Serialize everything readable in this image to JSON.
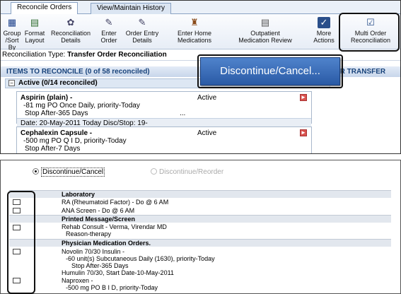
{
  "tabs": [
    {
      "label": "Reconcile Orders"
    },
    {
      "label": "View/Maintain History"
    }
  ],
  "toolbar": [
    {
      "icon": "group-sort-icon",
      "line1": "Group",
      "line2": "/Sort By"
    },
    {
      "icon": "format-layout-icon",
      "line1": "Format",
      "line2": "Layout"
    },
    {
      "icon": "reconciliation-details-icon",
      "line1": "Reconciliation",
      "line2": "Details"
    },
    {
      "icon": "enter-order-icon",
      "line1": "Enter",
      "line2": "Order"
    },
    {
      "icon": "order-entry-details-icon",
      "line1": "Order Entry",
      "line2": "Details"
    },
    {
      "icon": "enter-home-medications-icon",
      "line1": "Enter Home",
      "line2": "Medications"
    },
    {
      "icon": "outpatient-medication-review-icon",
      "line1": "Outpatient",
      "line2": "Medication Review"
    },
    {
      "icon": "more-actions-icon",
      "line1": "More",
      "line2": "Actions"
    },
    {
      "icon": "multi-order-reconciliation-icon",
      "line1": "Multi Order",
      "line2": "Reconciliation"
    }
  ],
  "recon_type": {
    "label": "Reconciliation Type:",
    "value": "Transfer Order Reconciliation"
  },
  "items_header": {
    "left": "ITEMS TO RECONCILE (0 of 58 reconciled)",
    "right": "ER TRANSFER"
  },
  "active_group": {
    "label": "Active (0/14 reconciled)"
  },
  "orders": [
    {
      "name": "Aspirin (plain) -",
      "status": "Active",
      "line2": "-81 mg PO Once  Daily, priority-Today",
      "line3": "Stop After-365 Days",
      "date": "Date: 20-May-2011 Today   Disc/Stop: 19-"
    },
    {
      "name": "Cephalexin Capsule -",
      "status": "Active",
      "line2": "-500 mg PO Q I D, priority-Today",
      "line3": "Stop After-7 Days"
    }
  ],
  "popup": {
    "label": "Discontinue/Cancel..."
  },
  "radios": [
    {
      "label": "Discontinue/Cancel",
      "selected": true
    },
    {
      "label": "Discontinue/Reorder",
      "selected": false
    }
  ],
  "groups": [
    "Laboratory",
    "Printed Message/Screen",
    "Physician Medication Orders."
  ],
  "lines": {
    "lab1": "RA (Rheumatoid Factor) - Do @ 6 AM",
    "lab2": "ANA Screen - Do @ 6 AM",
    "msg1": "Rehab Consult - Verma, Virendar MD",
    "msg2": "Reason-therapy",
    "med1": "Novolin 70/30 Insulin -",
    "med2": "-60 unit(s) Subcutaneous Daily (1630), priority-Today",
    "med3": "Stop After-365 Days",
    "med4": "Humulin 70/30,  Start Date-10-May-2011",
    "med5": "Naproxen -",
    "med6": "-500 mg PO B I D, priority-Today"
  }
}
